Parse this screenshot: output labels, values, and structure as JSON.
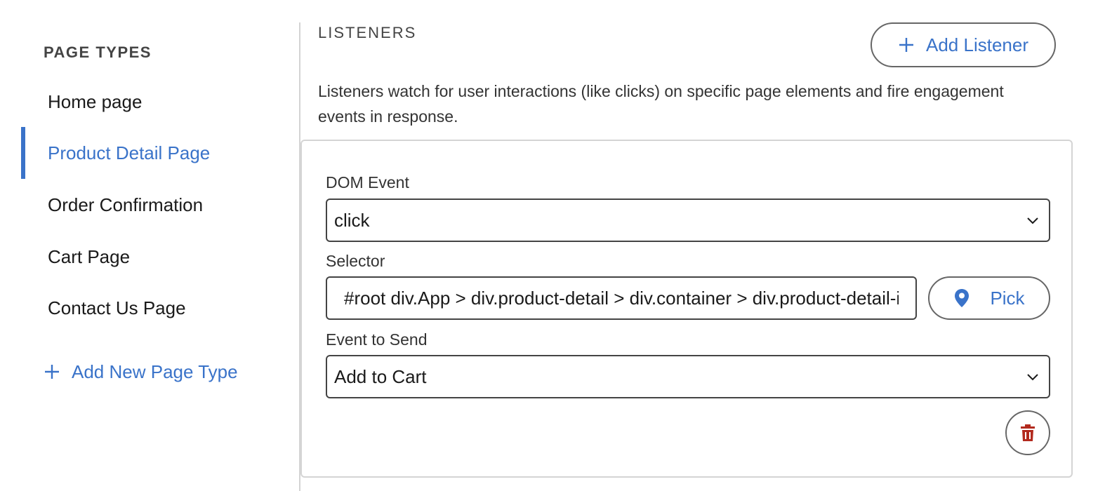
{
  "sidebar": {
    "heading": "PAGE TYPES",
    "items": [
      {
        "label": "Home page"
      },
      {
        "label": "Product Detail Page"
      },
      {
        "label": "Order Confirmation"
      },
      {
        "label": "Cart Page"
      },
      {
        "label": "Contact Us Page"
      }
    ],
    "add_label": "Add New Page Type"
  },
  "main": {
    "section_title": "LISTENERS",
    "add_listener_label": "Add Listener",
    "description": "Listeners watch for user interactions (like clicks) on specific page elements and fire engagement events in response.",
    "listener": {
      "dom_event_label": "DOM Event",
      "dom_event_value": "click",
      "selector_label": "Selector",
      "selector_value": "#root div.App > div.product-detail > div.container > div.product-detail-info > button",
      "pick_label": "Pick",
      "event_label": "Event to Send",
      "event_value": "Add to Cart"
    }
  },
  "colors": {
    "accent": "#3a73c9",
    "danger": "#b22a1e",
    "border": "#d4d4d4"
  },
  "icons": [
    "plus-icon",
    "chevron-down-icon",
    "location-pin-icon",
    "trash-icon"
  ]
}
